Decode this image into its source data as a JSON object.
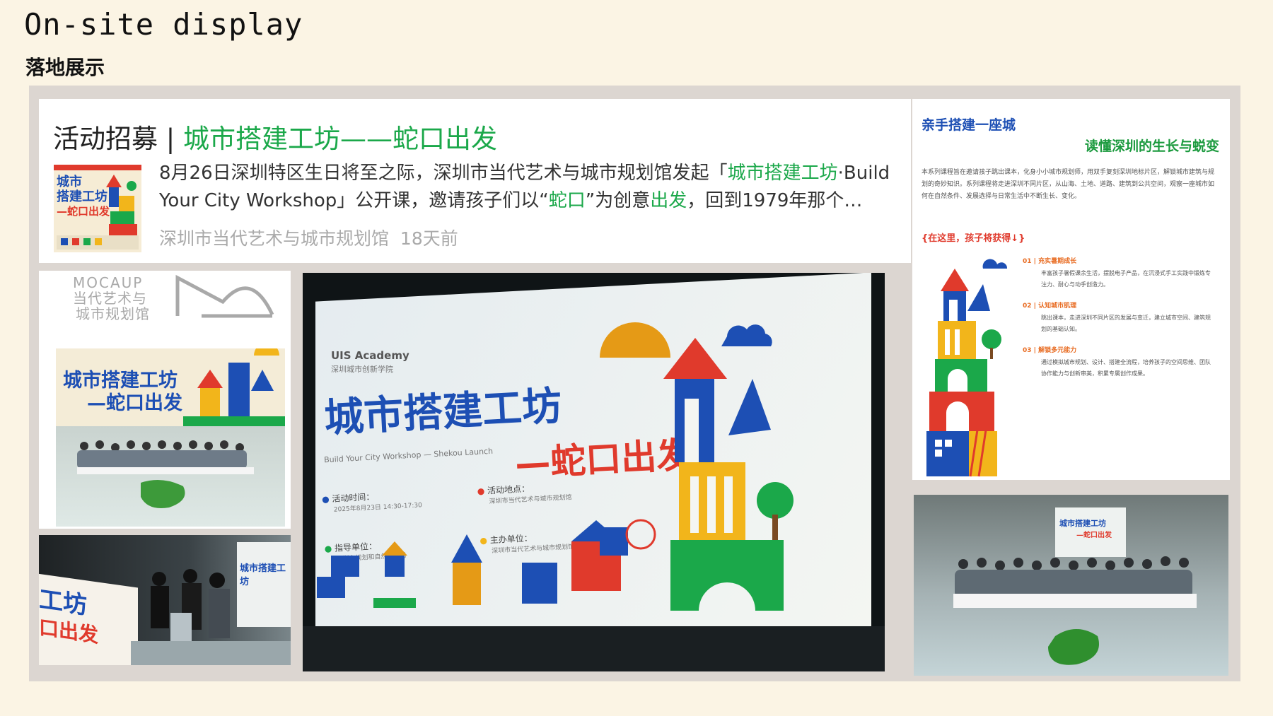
{
  "header": {
    "title_en": "On-site display",
    "title_zh": "落地展示"
  },
  "article": {
    "title_prefix": "活动招募 | ",
    "title_highlight": "城市搭建工坊——蛇口出发",
    "text": [
      {
        "t": "8月26日深圳特区生日将至之际，深圳市当代艺术与城市规划馆发起「",
        "g": false
      },
      {
        "t": "城市搭建工坊",
        "g": true
      },
      {
        "t": "·Build Your City Workshop」公开课，邀请孩子们以“",
        "g": false
      },
      {
        "t": "蛇口",
        "g": true
      },
      {
        "t": "”为创意",
        "g": false
      },
      {
        "t": "出发",
        "g": true
      },
      {
        "t": "，回到1979年那个…",
        "g": false
      }
    ],
    "source": "深圳市当代艺术与城市规划馆",
    "time": "18天前",
    "thumb_title_1": "城市",
    "thumb_title_2": "搭建工坊",
    "thumb_title_3": "—蛇口出发"
  },
  "poster": {
    "heading1": "亲手搭建一座城",
    "heading2": "读懂深圳的生长与蜕变",
    "intro": "本系列课程旨在邀请孩子跳出课本，化身小小城市规划师，用双手复刻深圳地标片区，解锁城市建筑与规划的奇妙知识。系列课程将走进深圳不同片区，从山海、土地、道路、建筑到公共空间，观察一座城市如何在自然条件、发展选择与日常生活中不断生长、变化。",
    "gain_label": "{在这里，孩子将获得↓}",
    "items": [
      {
        "title": "01 | 充实暑期成长",
        "desc": "丰富孩子暑假课余生活，摆脱电子产品，在沉浸式手工实践中锻炼专注力、耐心与动手创造力。"
      },
      {
        "title": "02 | 认知城市肌理",
        "desc": "跳出课本，走进深圳不同片区的发展与变迁，建立城市空间、建筑规划的基础认知。"
      },
      {
        "title": "03 | 解锁多元能力",
        "desc": "通过模拟城市规划、设计、搭建全流程，培养孩子的空间思维、团队协作能力与创新审美，积累专属创作成果。"
      }
    ]
  },
  "logo": {
    "brand": "MOCAUP",
    "line1": "当代艺术与",
    "line2": "城市规划馆"
  },
  "banner": {
    "institute": "UIS Academy",
    "institute_sub": "深圳城市创新学院",
    "title_line1": "城市搭建工坊",
    "title_line2": "—蛇口出发",
    "subtitle": "Build Your City Workshop — Shekou Launch",
    "info": [
      {
        "k": "活动时间：",
        "v": "2025年8月23日 14:30-17:30"
      },
      {
        "k": "活动地点：",
        "v": "深圳市当代艺术与城市规划馆"
      },
      {
        "k": "指导单位：",
        "v": "深圳市规划和自然资源局"
      },
      {
        "k": "主办单位：",
        "v": "深圳市当代艺术与城市规划馆"
      }
    ]
  },
  "people_banner": {
    "line1": "工坊",
    "line2": "口出发",
    "side": "城市搭建工坊"
  },
  "colors": {
    "green": "#1ba84a",
    "blue": "#1d4fb4",
    "red": "#e03a2c",
    "yellow": "#f2b51b",
    "orange": "#e86b21"
  }
}
